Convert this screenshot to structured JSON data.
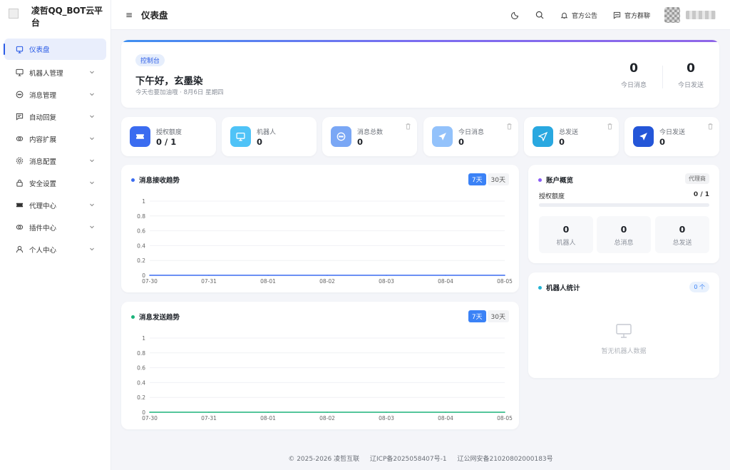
{
  "brand": {
    "title": "凌哲QQ_BOT云平台"
  },
  "sidebar": {
    "items": [
      {
        "label": "仪表盘",
        "icon": "dashboard-icon"
      },
      {
        "label": "机器人管理",
        "icon": "monitor-icon"
      },
      {
        "label": "消息管理",
        "icon": "chat-icon"
      },
      {
        "label": "自动回复",
        "icon": "message-square-icon"
      },
      {
        "label": "内容扩展",
        "icon": "link-icon"
      },
      {
        "label": "消息配置",
        "icon": "gear-icon"
      },
      {
        "label": "安全设置",
        "icon": "lock-icon"
      },
      {
        "label": "代理中心",
        "icon": "ticket-icon"
      },
      {
        "label": "插件中心",
        "icon": "plugin-icon"
      },
      {
        "label": "个人中心",
        "icon": "user-icon"
      }
    ]
  },
  "topbar": {
    "page_title": "仪表盘",
    "announcement_label": "官方公告",
    "group_label": "官方群聊"
  },
  "hero": {
    "tag": "控制台",
    "greeting": "下午好，玄墨染",
    "subtitle": "今天也要加油哦 · 8月6日 星期四",
    "stats": [
      {
        "value": "0",
        "label": "今日消息"
      },
      {
        "value": "0",
        "label": "今日发送"
      }
    ]
  },
  "stats": [
    {
      "label": "授权额度",
      "value": "0 / 1",
      "color": "#3b6cf0",
      "icon": "ticket-icon"
    },
    {
      "label": "机器人",
      "value": "0",
      "color": "#4fc3f7",
      "icon": "monitor-icon"
    },
    {
      "label": "消息总数",
      "value": "0",
      "color": "#7aa7f5",
      "icon": "chat-icon"
    },
    {
      "label": "今日消息",
      "value": "0",
      "color": "#93c2fb",
      "icon": "send-icon"
    },
    {
      "label": "总发送",
      "value": "0",
      "color": "#29a8e0",
      "icon": "send-outline-icon"
    },
    {
      "label": "今日发送",
      "value": "0",
      "color": "#2456d8",
      "icon": "send-icon"
    }
  ],
  "charts": {
    "receive": {
      "title": "消息接收趋势",
      "range_7": "7天",
      "range_30": "30天",
      "dot_color": "#3b6cf0"
    },
    "send": {
      "title": "消息发送趋势",
      "range_7": "7天",
      "range_30": "30天",
      "dot_color": "#1bb37a"
    }
  },
  "chart_data": [
    {
      "type": "line",
      "title": "消息接收趋势",
      "categories": [
        "07-30",
        "07-31",
        "08-01",
        "08-02",
        "08-03",
        "08-04",
        "08-05"
      ],
      "series": [
        {
          "values": [
            0,
            0,
            0,
            0,
            0,
            0,
            0
          ],
          "color": "#3b6cf0"
        }
      ],
      "yticks": [
        "0",
        "0.2",
        "0.4",
        "0.6",
        "0.8",
        "1"
      ],
      "ylim": [
        0,
        1
      ]
    },
    {
      "type": "line",
      "title": "消息发送趋势",
      "categories": [
        "07-30",
        "07-31",
        "08-01",
        "08-02",
        "08-03",
        "08-04",
        "08-05"
      ],
      "series": [
        {
          "values": [
            0,
            0,
            0,
            0,
            0,
            0,
            0
          ],
          "color": "#1bb37a"
        }
      ],
      "yticks": [
        "0",
        "0.2",
        "0.4",
        "0.6",
        "0.8",
        "1"
      ],
      "ylim": [
        0,
        1
      ]
    }
  ],
  "account": {
    "title": "账户概览",
    "badge": "代理商",
    "quota_label": "授权额度",
    "quota_value": "0 / 1",
    "quota_fraction": 0,
    "mini": [
      {
        "value": "0",
        "label": "机器人"
      },
      {
        "value": "0",
        "label": "总消息"
      },
      {
        "value": "0",
        "label": "总发送"
      }
    ],
    "dot_color": "#8b5cf6"
  },
  "robots": {
    "title": "机器人统计",
    "badge": "0 个",
    "empty_text": "暂无机器人数据",
    "dot_color": "#22b3d4"
  },
  "footer": {
    "copyright": "© 2025-2026 凌哲互联",
    "icp": "辽ICP备2025058407号-1",
    "police": "辽公网安备21020802000183号"
  }
}
